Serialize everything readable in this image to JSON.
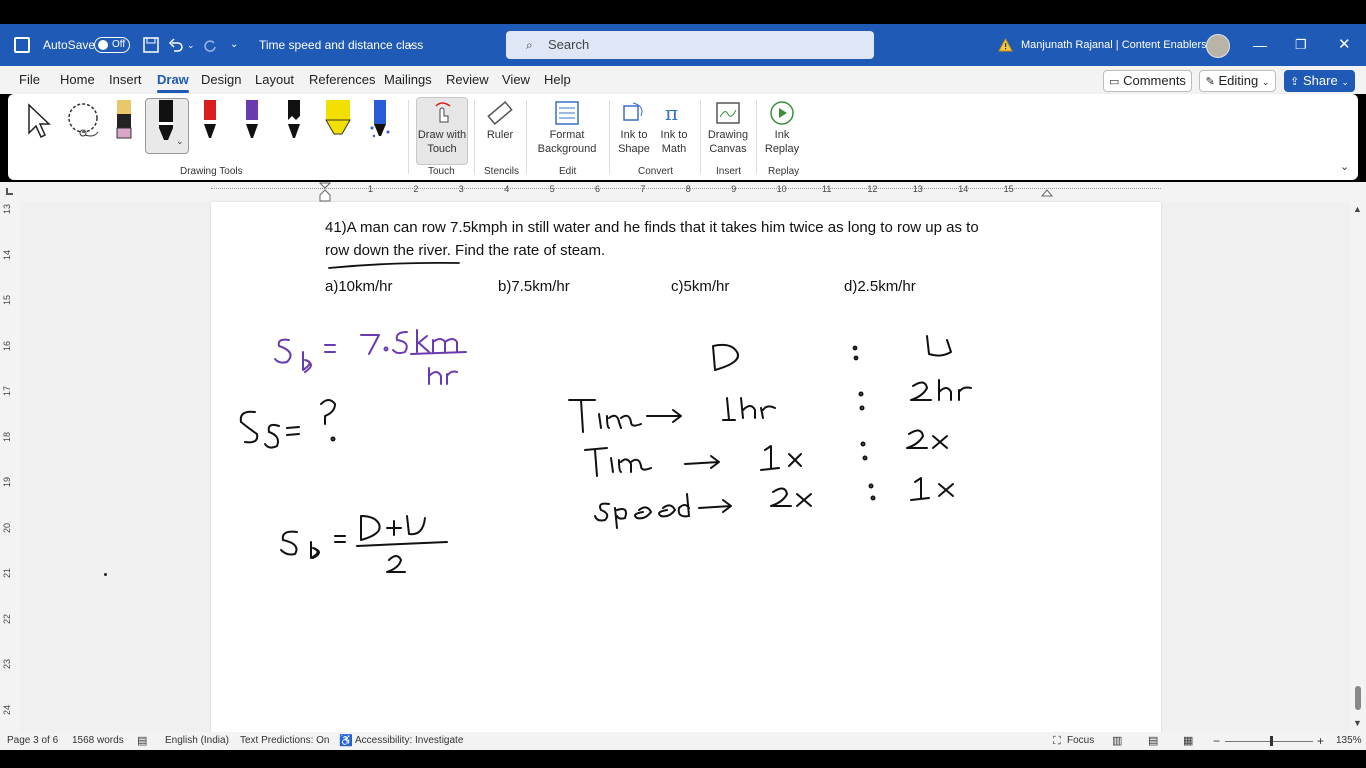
{
  "titlebar": {
    "autosave_label": "AutoSave",
    "autosave_state": "Off",
    "doc_title": "Time speed and distance class",
    "search_placeholder": "Search",
    "user_name": "Manjunath Rajanal | Content Enablers"
  },
  "menubar": {
    "tabs": [
      "File",
      "Home",
      "Insert",
      "Draw",
      "Design",
      "Layout",
      "References",
      "Mailings",
      "Review",
      "View",
      "Help"
    ],
    "active_tab": "Draw",
    "comments_label": "Comments",
    "editing_label": "Editing",
    "share_label": "Share"
  },
  "ribbon": {
    "groups": {
      "drawing_tools": "Drawing Tools",
      "touch": "Touch",
      "stencils": "Stencils",
      "edit": "Edit",
      "convert": "Convert",
      "insert": "Insert",
      "replay": "Replay"
    },
    "buttons": {
      "draw_with_touch": "Draw with Touch",
      "ruler": "Ruler",
      "format_background": "Format Background",
      "ink_to_shape": "Ink to Shape",
      "ink_to_math": "Ink to Math",
      "drawing_canvas": "Drawing Canvas",
      "ink_replay": "Ink Replay"
    },
    "pen_colors": [
      "#e8c86a",
      "#222222",
      "#d81e1e",
      "#6a3bb0",
      "#111111",
      "#f4e000",
      "#2a5bd7"
    ]
  },
  "ruler": {
    "h_numbers": [
      "1",
      "2",
      "3",
      "4",
      "5",
      "6",
      "7",
      "8",
      "9",
      "10",
      "11",
      "12",
      "13",
      "14",
      "15"
    ],
    "v_numbers": [
      "13",
      "14",
      "15",
      "16",
      "17",
      "18",
      "19",
      "20",
      "21",
      "22",
      "23",
      "24"
    ]
  },
  "document": {
    "question_line1": "41)A man can row 7.5kmph in still water and he finds that it takes him twice as long to row up as to",
    "question_line2": "row down the river. Find the rate of steam.",
    "options": [
      "a)10km/hr",
      "b)7.5km/hr",
      "c)5km/hr",
      "d)2.5km/hr"
    ],
    "ink": {
      "sb_eq": "SB = 7·5 km/hr",
      "ss_eq": "Ss = ?",
      "sb_formula": "SB = (D+U)/2",
      "col_d": "D",
      "col_u": "U",
      "time_row": "Time → 1hr : 2hr",
      "time_row2": "Time → 1x : 2x",
      "speed_row": "speed → 2x : 1x"
    },
    "ink_colors": {
      "purple": "#6a3bb0",
      "black": "#111111"
    }
  },
  "statusbar": {
    "page": "Page 3 of 6",
    "words": "1568 words",
    "language": "English (India)",
    "text_predictions": "Text Predictions: On",
    "accessibility": "Accessibility: Investigate",
    "focus": "Focus",
    "zoom": "135%"
  },
  "colors": {
    "brand": "#1e5ab6"
  }
}
